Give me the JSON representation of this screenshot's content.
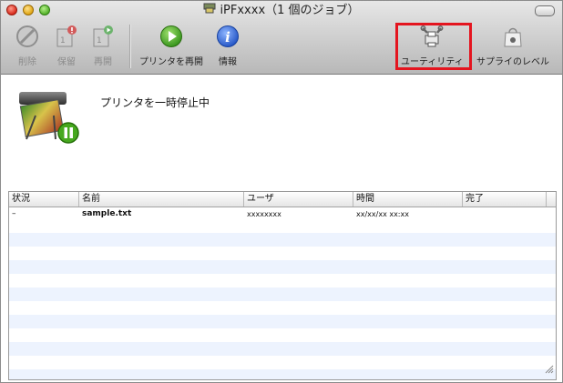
{
  "window": {
    "title": "iPFxxxx（1 個のジョブ）"
  },
  "toolbar": {
    "delete_label": "削除",
    "hold_label": "保留",
    "resume_label": "再開",
    "resume_printer_label": "プリンタを再開",
    "info_label": "情報",
    "utility_label": "ユーティリティ",
    "supply_levels_label": "サプライのレベル"
  },
  "status": {
    "message": "プリンタを一時停止中"
  },
  "jobs_table": {
    "columns": [
      "状況",
      "名前",
      "ユーザ",
      "時間",
      "完了"
    ],
    "rows": [
      {
        "status": "–",
        "name": "sample.txt",
        "user": "xxxxxxxx",
        "time": "xx/xx/xx xx:xx",
        "done": ""
      }
    ]
  },
  "colors": {
    "highlight_border": "#e4151f",
    "row_stripe": "#edf3fe",
    "toolbar_top": "#e7e7e7",
    "toolbar_bottom": "#b8b8b8"
  },
  "icons": {
    "delete": "no-entry-icon",
    "hold": "document-pause-icon",
    "resume": "document-play-icon",
    "resume_printer": "play-circle-icon",
    "info": "info-icon",
    "utility": "wrench-printer-icon",
    "supply_levels": "shopping-bag-icon",
    "printer": "large-format-printer-icon"
  }
}
